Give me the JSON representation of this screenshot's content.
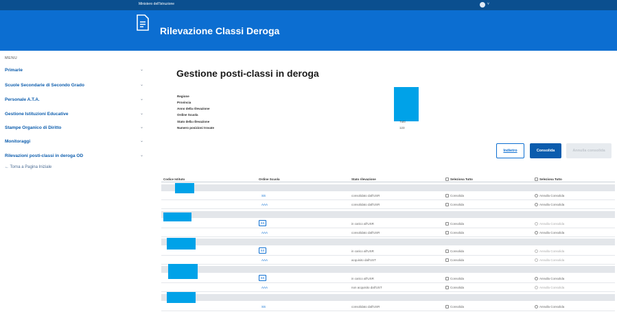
{
  "topbar": {
    "ministry": "Ministero dell'Istruzione",
    "user_caret": "˅"
  },
  "header": {
    "title": "Rilevazione Classi Deroga",
    "icon": "document-icon"
  },
  "sidebar": {
    "menu_label": "MENU",
    "items": [
      {
        "label": "Primarie"
      },
      {
        "label": "Scuole Secondarie di Secondo Grado"
      },
      {
        "label": "Personale A.T.A."
      },
      {
        "label": "Gestione Istituzioni Educative"
      },
      {
        "label": "Stampe Organico di Diritto"
      },
      {
        "label": "Monitoraggi"
      },
      {
        "label": "Rilevazioni posti-classi in deroga OD"
      }
    ],
    "back_link": "←  Torna a Pagina Iniziale"
  },
  "main": {
    "title": "Gestione posti-classi in deroga",
    "info_labels": [
      "Regione",
      "Provincia",
      "Anno della rilevazione",
      "Ordine Scuola",
      "Stato della rilevazione",
      "Numero posizioni trovate"
    ],
    "info_values": {
      "stato": "Tutti",
      "numero": "123"
    },
    "buttons": {
      "back": "Indietro",
      "confirm": "Consolida",
      "disabled": "Annulla consolida"
    },
    "redact_color": "#00a2e8"
  },
  "table": {
    "headers": [
      "Codice Istituto",
      "Ordine Scuola",
      "Stato rilevazione",
      "Seleziona Tutto",
      "Seleziona Tutto"
    ],
    "rows": [
      {
        "code": "SS",
        "stato": "consolidato dall'USR",
        "chk": "Consolida",
        "radio": "Annulla Consolida",
        "boxed": false,
        "dim": false
      },
      {
        "code": "AAA",
        "stato": "consolidato dall'USR",
        "chk": "Consolida",
        "radio": "Annulla Consolida",
        "boxed": false,
        "dim": false
      },
      {
        "code": "SS",
        "stato": "in carico all'USR",
        "chk": "Consolida",
        "radio": "Annulla Consolida",
        "boxed": true,
        "dim": true
      },
      {
        "code": "AAA",
        "stato": "consolidato dall'USR",
        "chk": "Consolida",
        "radio": "Annulla Consolida",
        "boxed": false,
        "dim": false
      },
      {
        "code": "SS",
        "stato": "in carico all'USR",
        "chk": "Consolida",
        "radio": "Annulla Consolida",
        "boxed": true,
        "dim": true
      },
      {
        "code": "AAA",
        "stato": "acquisito dall'UST",
        "chk": "Consolida",
        "radio": "Annulla Consolida",
        "boxed": false,
        "dim": true
      },
      {
        "code": "SS",
        "stato": "in carico all'USR",
        "chk": "Consolida",
        "radio": "Annulla Consolida",
        "boxed": true,
        "dim": false
      },
      {
        "code": "AAA",
        "stato": "non acquisito dall'UST",
        "chk": "Consolida",
        "radio": "Annulla Consolida",
        "boxed": false,
        "dim": true
      },
      {
        "code": "SS",
        "stato": "consolidato dall'USR",
        "chk": "Consolida",
        "radio": "Annulla Consolida",
        "boxed": false,
        "dim": false
      }
    ]
  }
}
